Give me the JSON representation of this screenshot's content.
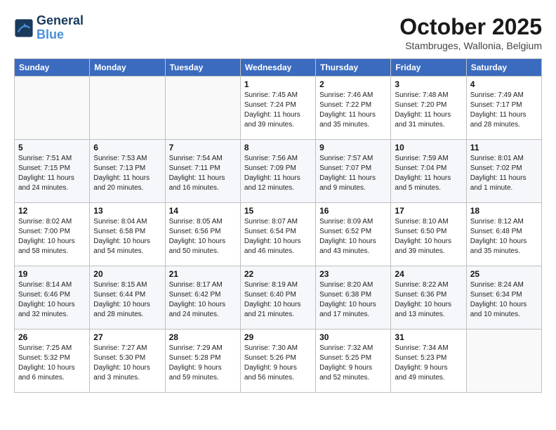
{
  "header": {
    "logo_line1": "General",
    "logo_line2": "Blue",
    "month": "October 2025",
    "location": "Stambruges, Wallonia, Belgium"
  },
  "weekdays": [
    "Sunday",
    "Monday",
    "Tuesday",
    "Wednesday",
    "Thursday",
    "Friday",
    "Saturday"
  ],
  "weeks": [
    [
      {
        "day": "",
        "info": ""
      },
      {
        "day": "",
        "info": ""
      },
      {
        "day": "",
        "info": ""
      },
      {
        "day": "1",
        "info": "Sunrise: 7:45 AM\nSunset: 7:24 PM\nDaylight: 11 hours\nand 39 minutes."
      },
      {
        "day": "2",
        "info": "Sunrise: 7:46 AM\nSunset: 7:22 PM\nDaylight: 11 hours\nand 35 minutes."
      },
      {
        "day": "3",
        "info": "Sunrise: 7:48 AM\nSunset: 7:20 PM\nDaylight: 11 hours\nand 31 minutes."
      },
      {
        "day": "4",
        "info": "Sunrise: 7:49 AM\nSunset: 7:17 PM\nDaylight: 11 hours\nand 28 minutes."
      }
    ],
    [
      {
        "day": "5",
        "info": "Sunrise: 7:51 AM\nSunset: 7:15 PM\nDaylight: 11 hours\nand 24 minutes."
      },
      {
        "day": "6",
        "info": "Sunrise: 7:53 AM\nSunset: 7:13 PM\nDaylight: 11 hours\nand 20 minutes."
      },
      {
        "day": "7",
        "info": "Sunrise: 7:54 AM\nSunset: 7:11 PM\nDaylight: 11 hours\nand 16 minutes."
      },
      {
        "day": "8",
        "info": "Sunrise: 7:56 AM\nSunset: 7:09 PM\nDaylight: 11 hours\nand 12 minutes."
      },
      {
        "day": "9",
        "info": "Sunrise: 7:57 AM\nSunset: 7:07 PM\nDaylight: 11 hours\nand 9 minutes."
      },
      {
        "day": "10",
        "info": "Sunrise: 7:59 AM\nSunset: 7:04 PM\nDaylight: 11 hours\nand 5 minutes."
      },
      {
        "day": "11",
        "info": "Sunrise: 8:01 AM\nSunset: 7:02 PM\nDaylight: 11 hours\nand 1 minute."
      }
    ],
    [
      {
        "day": "12",
        "info": "Sunrise: 8:02 AM\nSunset: 7:00 PM\nDaylight: 10 hours\nand 58 minutes."
      },
      {
        "day": "13",
        "info": "Sunrise: 8:04 AM\nSunset: 6:58 PM\nDaylight: 10 hours\nand 54 minutes."
      },
      {
        "day": "14",
        "info": "Sunrise: 8:05 AM\nSunset: 6:56 PM\nDaylight: 10 hours\nand 50 minutes."
      },
      {
        "day": "15",
        "info": "Sunrise: 8:07 AM\nSunset: 6:54 PM\nDaylight: 10 hours\nand 46 minutes."
      },
      {
        "day": "16",
        "info": "Sunrise: 8:09 AM\nSunset: 6:52 PM\nDaylight: 10 hours\nand 43 minutes."
      },
      {
        "day": "17",
        "info": "Sunrise: 8:10 AM\nSunset: 6:50 PM\nDaylight: 10 hours\nand 39 minutes."
      },
      {
        "day": "18",
        "info": "Sunrise: 8:12 AM\nSunset: 6:48 PM\nDaylight: 10 hours\nand 35 minutes."
      }
    ],
    [
      {
        "day": "19",
        "info": "Sunrise: 8:14 AM\nSunset: 6:46 PM\nDaylight: 10 hours\nand 32 minutes."
      },
      {
        "day": "20",
        "info": "Sunrise: 8:15 AM\nSunset: 6:44 PM\nDaylight: 10 hours\nand 28 minutes."
      },
      {
        "day": "21",
        "info": "Sunrise: 8:17 AM\nSunset: 6:42 PM\nDaylight: 10 hours\nand 24 minutes."
      },
      {
        "day": "22",
        "info": "Sunrise: 8:19 AM\nSunset: 6:40 PM\nDaylight: 10 hours\nand 21 minutes."
      },
      {
        "day": "23",
        "info": "Sunrise: 8:20 AM\nSunset: 6:38 PM\nDaylight: 10 hours\nand 17 minutes."
      },
      {
        "day": "24",
        "info": "Sunrise: 8:22 AM\nSunset: 6:36 PM\nDaylight: 10 hours\nand 13 minutes."
      },
      {
        "day": "25",
        "info": "Sunrise: 8:24 AM\nSunset: 6:34 PM\nDaylight: 10 hours\nand 10 minutes."
      }
    ],
    [
      {
        "day": "26",
        "info": "Sunrise: 7:25 AM\nSunset: 5:32 PM\nDaylight: 10 hours\nand 6 minutes."
      },
      {
        "day": "27",
        "info": "Sunrise: 7:27 AM\nSunset: 5:30 PM\nDaylight: 10 hours\nand 3 minutes."
      },
      {
        "day": "28",
        "info": "Sunrise: 7:29 AM\nSunset: 5:28 PM\nDaylight: 9 hours\nand 59 minutes."
      },
      {
        "day": "29",
        "info": "Sunrise: 7:30 AM\nSunset: 5:26 PM\nDaylight: 9 hours\nand 56 minutes."
      },
      {
        "day": "30",
        "info": "Sunrise: 7:32 AM\nSunset: 5:25 PM\nDaylight: 9 hours\nand 52 minutes."
      },
      {
        "day": "31",
        "info": "Sunrise: 7:34 AM\nSunset: 5:23 PM\nDaylight: 9 hours\nand 49 minutes."
      },
      {
        "day": "",
        "info": ""
      }
    ]
  ]
}
